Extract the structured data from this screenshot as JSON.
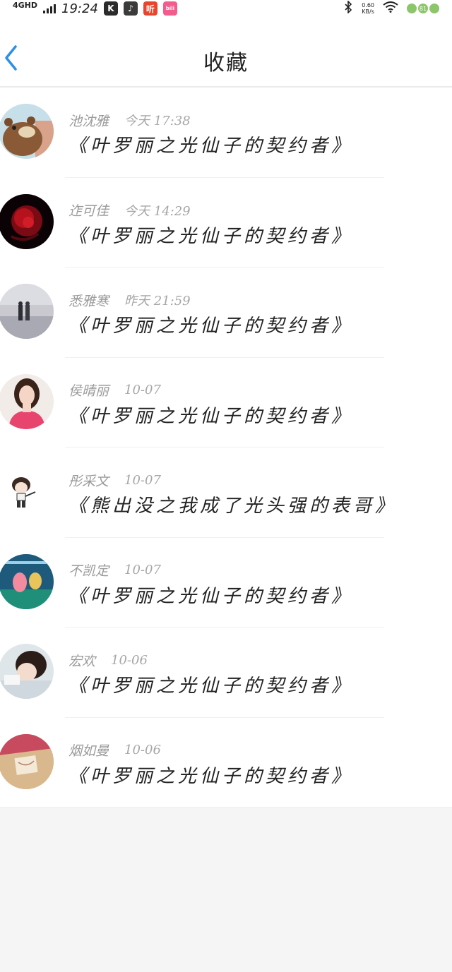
{
  "status_bar": {
    "network": "4GHD",
    "time": "19:24",
    "apps": [
      "K",
      "♪",
      "听",
      "bili"
    ],
    "net_speed_value": "0.60",
    "net_speed_unit": "KB/s",
    "battery": "81"
  },
  "header": {
    "title": "收藏"
  },
  "favorites": [
    {
      "user": "池沈雅",
      "time": "今天 17:38",
      "book": "《叶罗丽之光仙子的契约者》"
    },
    {
      "user": "迮可佳",
      "time": "今天 14:29",
      "book": "《叶罗丽之光仙子的契约者》"
    },
    {
      "user": "悉雅寒",
      "time": "昨天 21:59",
      "book": "《叶罗丽之光仙子的契约者》"
    },
    {
      "user": "侯晴丽",
      "time": "10-07",
      "book": "《叶罗丽之光仙子的契约者》"
    },
    {
      "user": "彤采文",
      "time": "10-07",
      "book": "《熊出没之我成了光头强的表哥》"
    },
    {
      "user": "不凯定",
      "time": "10-07",
      "book": "《叶罗丽之光仙子的契约者》"
    },
    {
      "user": "宏欢",
      "time": "10-06",
      "book": "《叶罗丽之光仙子的契约者》"
    },
    {
      "user": "烟如曼",
      "time": "10-06",
      "book": "《叶罗丽之光仙子的契约者》"
    }
  ],
  "colors": {
    "accent": "#2d8fe6",
    "background": "#f6f5f6",
    "meta_text": "#9a9a9a",
    "title_text": "#222222"
  },
  "icons": {
    "back": "chevron-left-icon"
  }
}
